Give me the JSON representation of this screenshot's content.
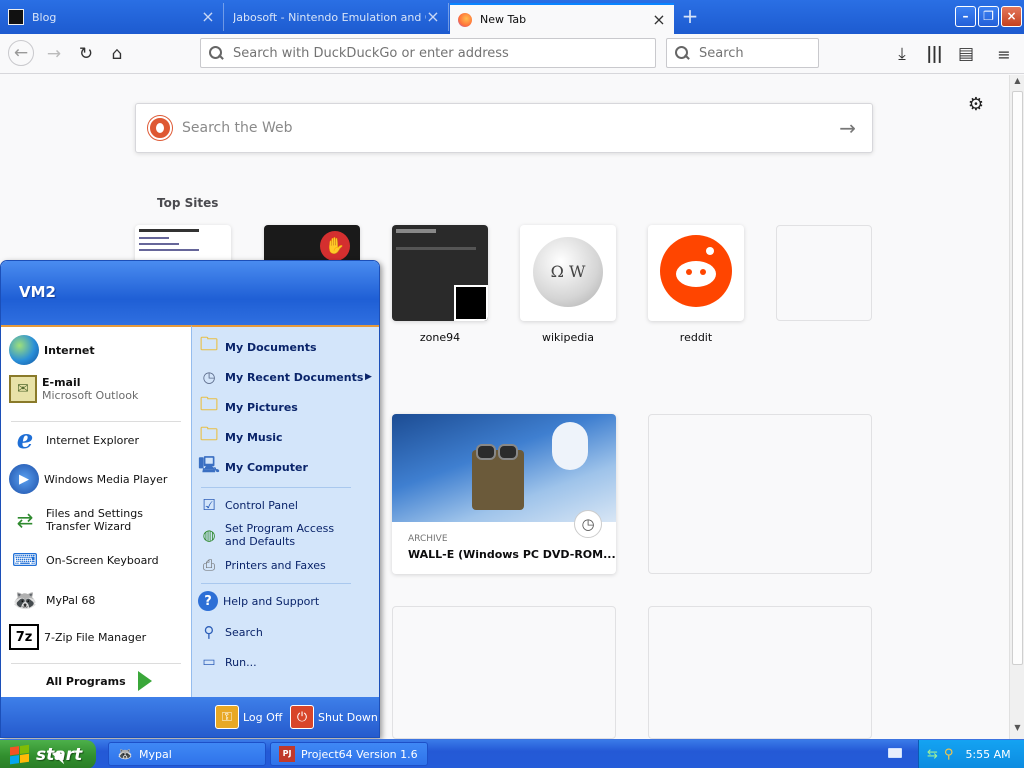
{
  "browser": {
    "tabs": [
      {
        "title": "Blog"
      },
      {
        "title": "Jabosoft - Nintendo Emulation and Ot"
      },
      {
        "title": "New Tab"
      }
    ],
    "url_placeholder": "Search with DuckDuckGo or enter address",
    "search_placeholder": "Search",
    "accent": "#0a84ff"
  },
  "newtab": {
    "websearch_placeholder": "Search the Web",
    "topsites_title": "Top Sites",
    "sites": [
      {
        "label": ""
      },
      {
        "label": ""
      },
      {
        "label": "zone94"
      },
      {
        "label": "wikipedia"
      },
      {
        "label": "reddit"
      },
      {
        "label": ""
      }
    ],
    "highlight": {
      "source": "ARCHIVE",
      "title": "WALL-E (Windows PC DVD-ROM..."
    }
  },
  "startmenu": {
    "user": "VM2",
    "pinned": [
      {
        "label": "Internet"
      },
      {
        "label": "E-mail",
        "sub": "Microsoft Outlook"
      }
    ],
    "recent": [
      {
        "label": "Internet Explorer"
      },
      {
        "label": "Windows Media Player"
      },
      {
        "label": "Files and Settings Transfer Wizard"
      },
      {
        "label": "On-Screen Keyboard"
      },
      {
        "label": "MyPal 68"
      },
      {
        "label": "7-Zip File Manager"
      }
    ],
    "all_programs": "All Programs",
    "places": [
      {
        "label": "My Documents"
      },
      {
        "label": "My Recent Documents"
      },
      {
        "label": "My Pictures"
      },
      {
        "label": "My Music"
      },
      {
        "label": "My Computer"
      }
    ],
    "settings": [
      {
        "label": "Control Panel"
      },
      {
        "label": "Set Program Access and Defaults"
      },
      {
        "label": "Printers and Faxes"
      }
    ],
    "tools": [
      {
        "label": "Help and Support"
      },
      {
        "label": "Search"
      },
      {
        "label": "Run..."
      }
    ],
    "log_off": "Log Off",
    "shut_down": "Shut Down"
  },
  "taskbar": {
    "start_label": "start",
    "tasks": [
      {
        "label": "Mypal"
      },
      {
        "label": "Project64 Version 1.6"
      }
    ],
    "clock": "5:55 AM"
  }
}
